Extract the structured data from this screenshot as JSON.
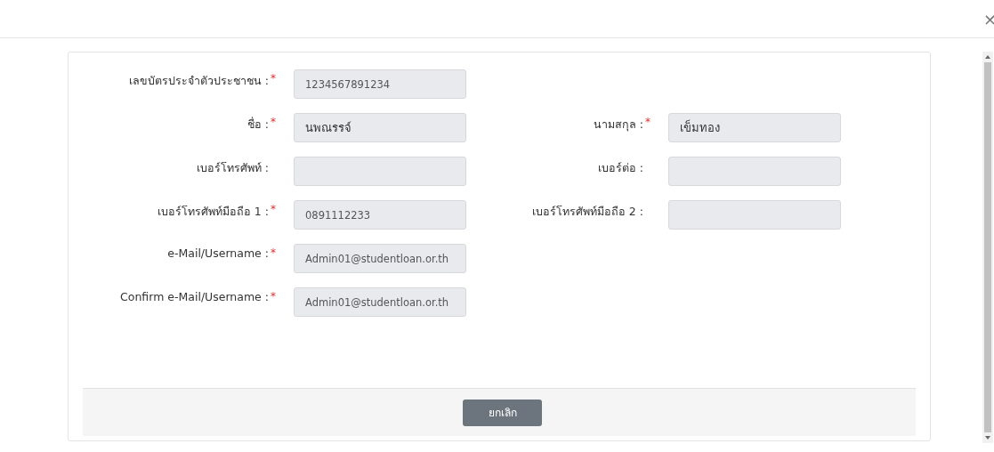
{
  "close": "×",
  "rows": [
    {
      "fields": [
        {
          "label": "เลขบัตรประจำตัวประชาชน :",
          "required": true,
          "value": "1234567891234"
        }
      ]
    },
    {
      "fields": [
        {
          "label": "ชื่อ :",
          "required": true,
          "value": "นพณรรจ์"
        },
        {
          "label": "นามสกุล :",
          "required": true,
          "value": "เข็มทอง"
        }
      ]
    },
    {
      "fields": [
        {
          "label": "เบอร์โทรศัพท์ :",
          "required": false
        },
        {
          "label": "เบอร์ต่อ :",
          "required": false
        }
      ]
    },
    {
      "fields": [
        {
          "label": "เบอร์โทรศัพท์มือถือ 1 :",
          "required": true,
          "value": "0891112233"
        },
        {
          "label": "เบอร์โทรศัพท์มือถือ 2 :",
          "required": false
        }
      ]
    },
    {
      "fields": [
        {
          "label": "e-Mail/Username :",
          "required": true,
          "value": "Admin01@studentloan.or.th"
        }
      ]
    },
    {
      "fields": [
        {
          "label": "Confirm e-Mail/Username :",
          "required": true,
          "value": "Admin01@studentloan.or.th"
        }
      ]
    }
  ],
  "required_mark": "*",
  "cancel_button": "ยกเลิก"
}
